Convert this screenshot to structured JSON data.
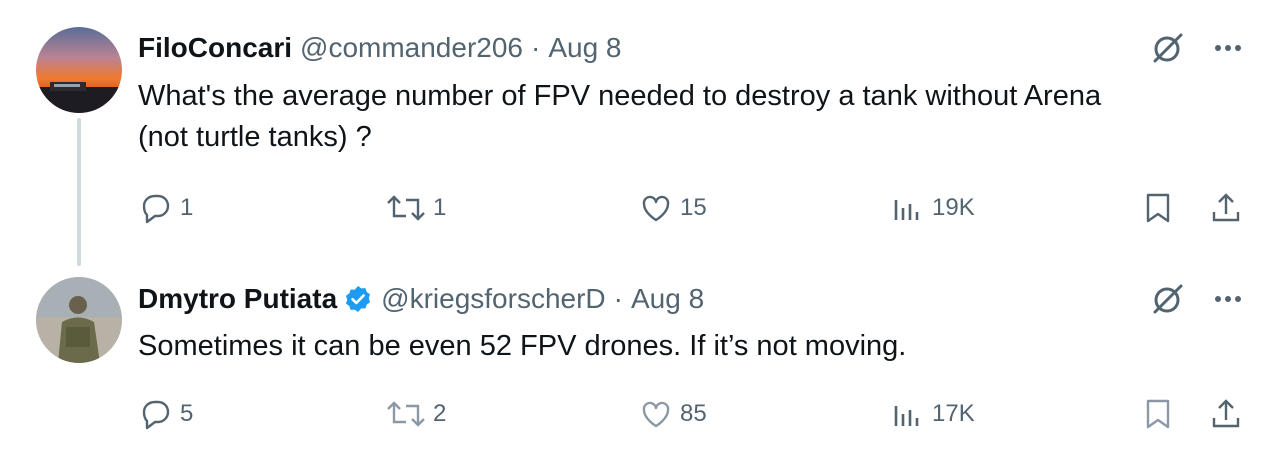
{
  "tweets": [
    {
      "display_name": "FiloConcari",
      "handle": "@commander206",
      "separator": "·",
      "date": "Aug 8",
      "verified": false,
      "text_lines": [
        "What's the average number of FPV needed to destroy a tank without Arena",
        "(not turtle tanks) ?"
      ],
      "replies": "1",
      "reposts": "1",
      "likes": "15",
      "views": "19K",
      "avatar_icon": "sunset-avatar"
    },
    {
      "display_name": "Dmytro Putiata",
      "handle": "@kriegsforscherD",
      "separator": "·",
      "date": "Aug 8",
      "verified": true,
      "text_lines": [
        "Sometimes it can be even 52 FPV drones. If it’s not moving."
      ],
      "replies": "5",
      "reposts": "2",
      "likes": "85",
      "views": "17K",
      "avatar_icon": "soldier-avatar"
    }
  ],
  "colors": {
    "text": "#0f1419",
    "secondary": "#536471",
    "verified": "#1d9bf0",
    "thread_line": "#cfd9de"
  },
  "icons": [
    "grok-icon",
    "more-icon",
    "reply-icon",
    "repost-icon",
    "like-icon",
    "views-icon",
    "bookmark-icon",
    "share-icon",
    "verified-badge-icon"
  ]
}
